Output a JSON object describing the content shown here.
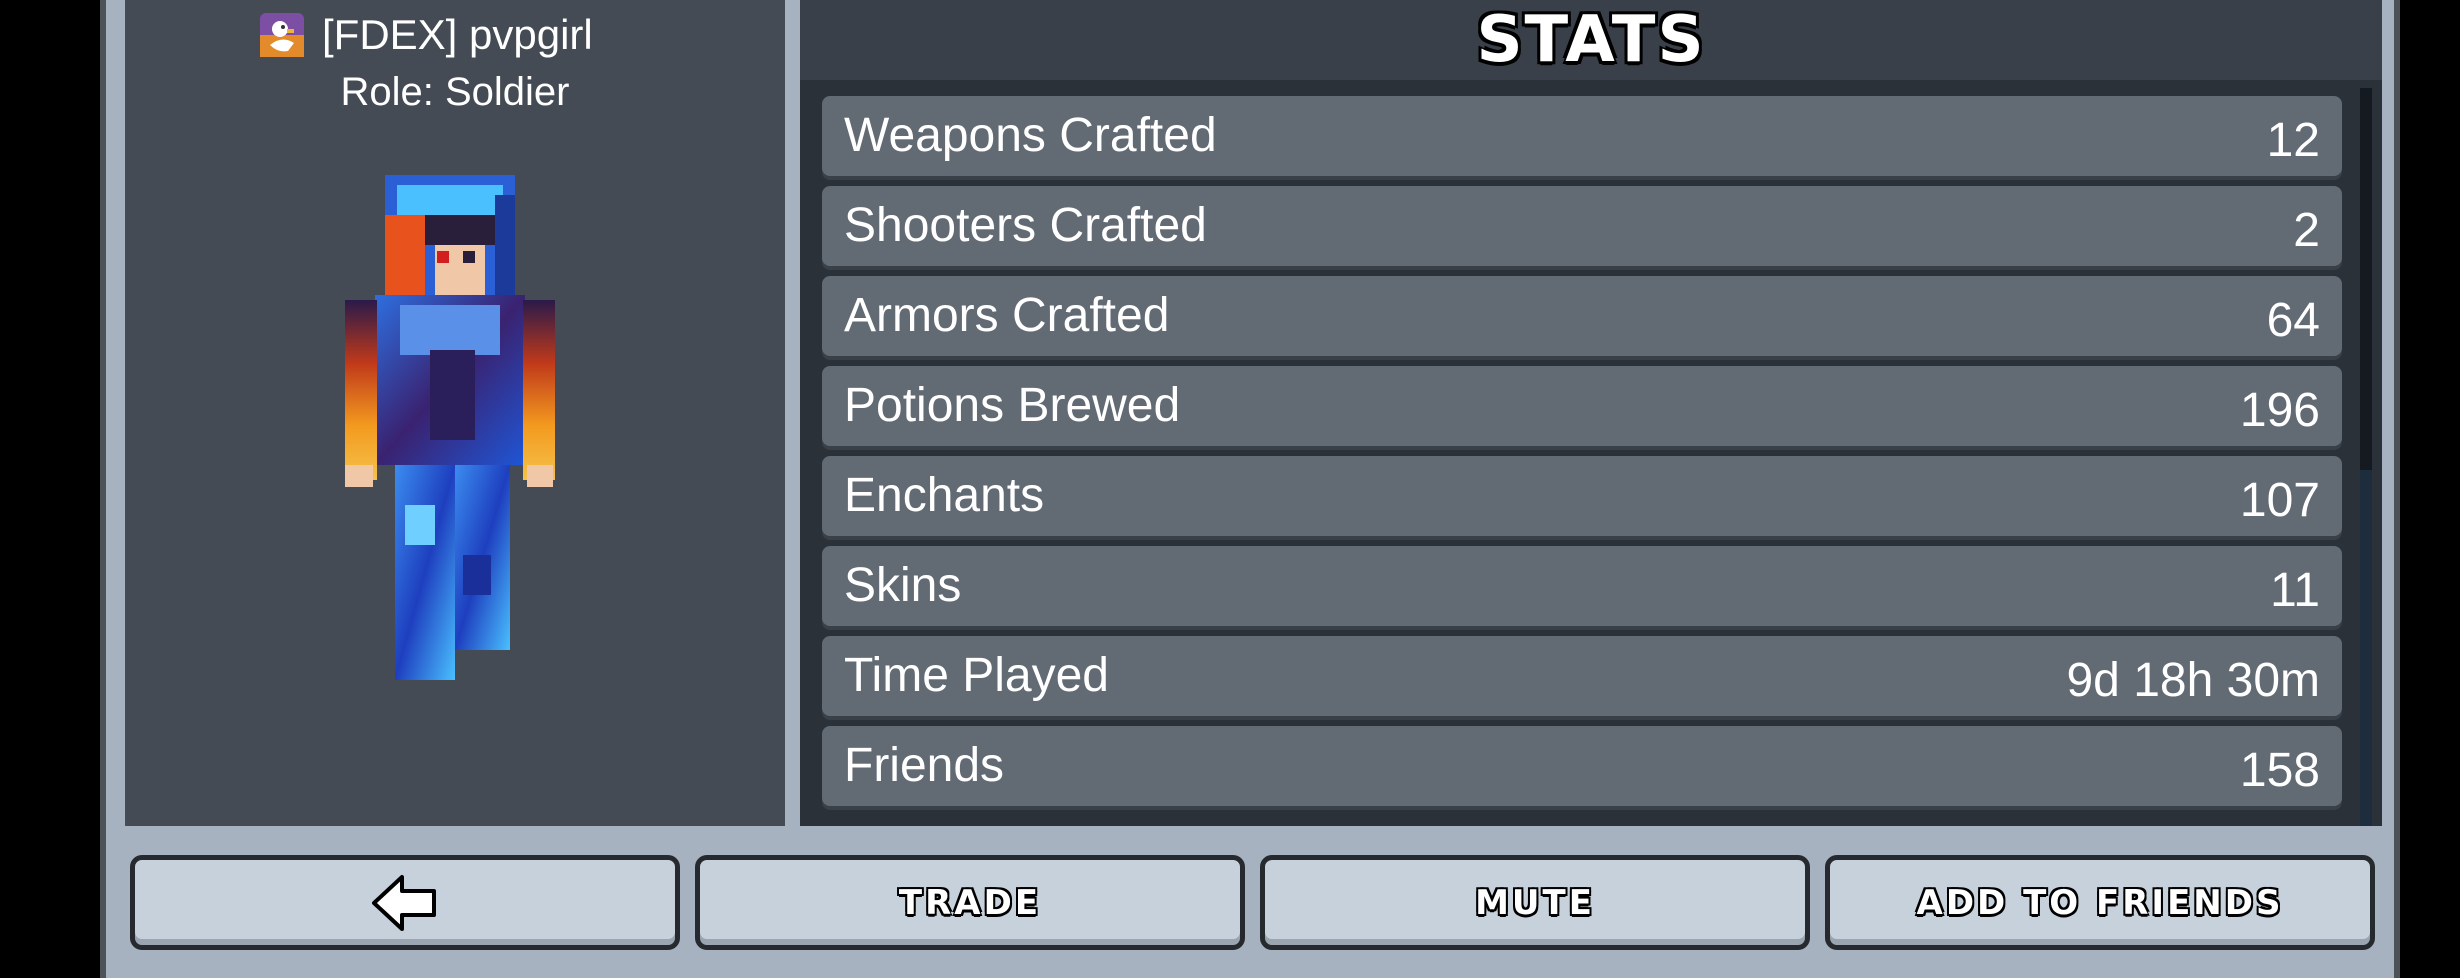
{
  "player": {
    "clan_tag_name": "[FDEX] pvpgirl",
    "role": "Role: Soldier"
  },
  "stats_panel": {
    "title": "STATS",
    "rows": [
      {
        "label": "Weapons Crafted",
        "value": "12"
      },
      {
        "label": "Shooters Crafted",
        "value": "2"
      },
      {
        "label": "Armors Crafted",
        "value": "64"
      },
      {
        "label": "Potions Brewed",
        "value": "196"
      },
      {
        "label": "Enchants",
        "value": "107"
      },
      {
        "label": "Skins",
        "value": "11"
      },
      {
        "label": "Time Played",
        "value": "9d 18h 30m"
      },
      {
        "label": "Friends",
        "value": "158"
      }
    ]
  },
  "buttons": {
    "back_icon": "left-arrow-icon",
    "trade": "TRADE",
    "mute": "MUTE",
    "add_friend": "ADD TO FRIENDS"
  },
  "colors": {
    "panel_bg": "#444b54",
    "row_bg": "#626a74",
    "button_bg": "#c7d1db"
  }
}
